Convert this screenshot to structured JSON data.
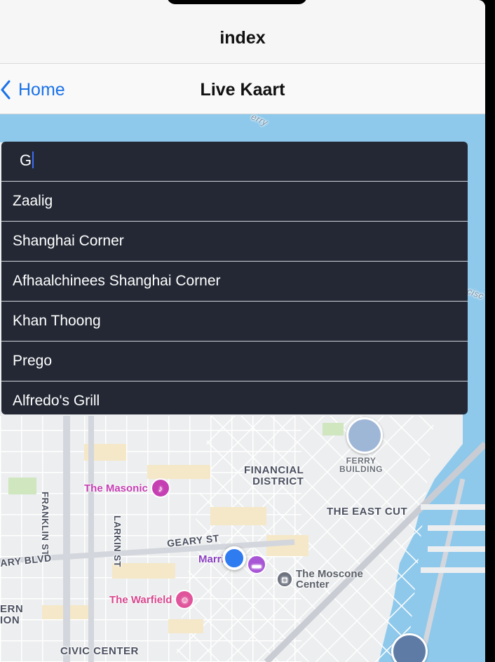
{
  "browser": {
    "tab_title": "index"
  },
  "nav": {
    "back_label": "Home",
    "title": "Live Kaart",
    "back_icon": "chevron-left-icon"
  },
  "search": {
    "value": "G"
  },
  "suggestions": [
    "Zaalig",
    "Shanghai Corner",
    "Afhaalchinees Shanghai Corner",
    "Khan Thoong",
    "Prego",
    "Alfredo's Grill"
  ],
  "map": {
    "labels": {
      "ferry_top": "erry",
      "cisco": "cisc",
      "financial_district": "FINANCIAL\nDISTRICT",
      "ferry_building": "FERRY\nBUILDING",
      "east_cut": "THE EAST CUT",
      "franklin_st": "FRANKLIN ST",
      "larkin_st": "LARKIN ST",
      "geary_st": "GEARY ST",
      "geary_blvd": "ARY BLVD",
      "ern_ion": "ERN\nION",
      "civic_center": "CIVIC CENTER",
      "the_masonic": "The Masonic",
      "the_warfield": "The Warfield",
      "marriott": "Marri",
      "moscone": "The Moscone\nCenter"
    },
    "colors": {
      "water": "#8ec9ec",
      "land": "#eceeef",
      "user_location": "#2f7bf0",
      "masonic": "#c53fb3",
      "warfield": "#e0549b"
    }
  }
}
